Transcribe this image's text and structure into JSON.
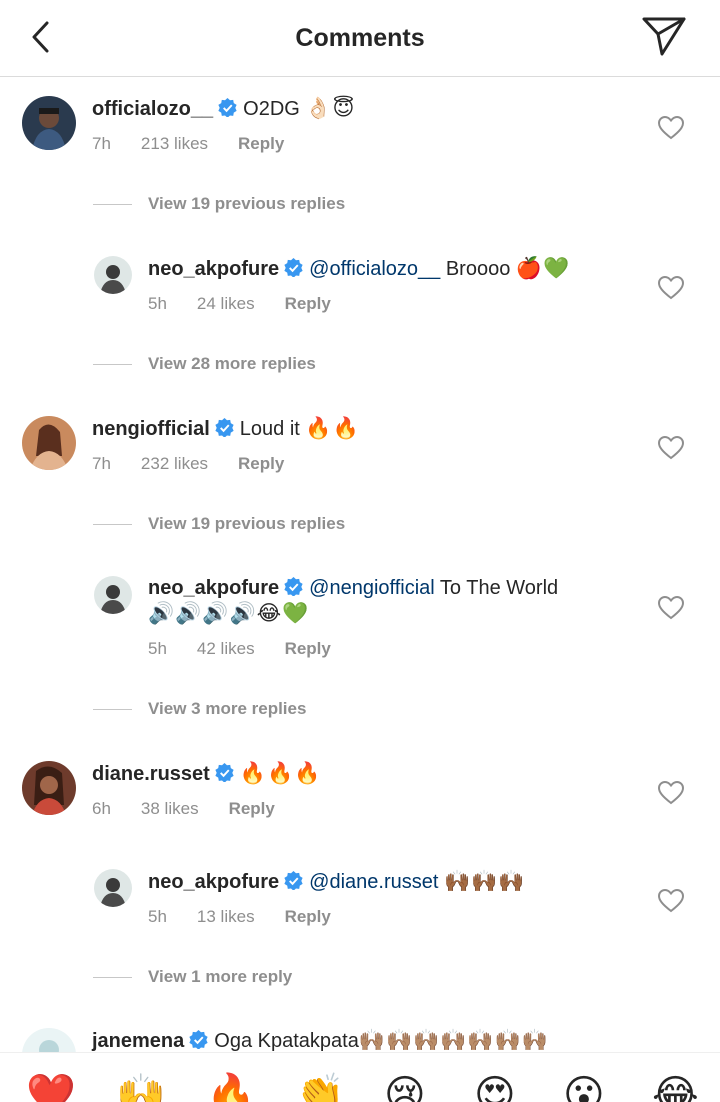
{
  "header": {
    "title": "Comments",
    "back_icon": "chevron-left-icon",
    "send_icon": "paper-plane-icon"
  },
  "comments": [
    {
      "username": "officialozo__",
      "text": "O2DG",
      "emoji": "👌🏻😇",
      "time": "7h",
      "likes": "213 likes",
      "reply": "Reply",
      "view_link": "View 19 previous replies",
      "reply_item": {
        "username": "neo_akpofure",
        "mention": "@officialozo__",
        "text": " Broooo",
        "emoji": "🍎💚",
        "time": "5h",
        "likes": "24 likes",
        "reply": "Reply"
      },
      "more_link": "View 28 more replies"
    },
    {
      "username": "nengiofficial",
      "text": "Loud it",
      "emoji": "🔥🔥",
      "time": "7h",
      "likes": "232 likes",
      "reply": "Reply",
      "view_link": "View 19 previous replies",
      "reply_item": {
        "username": "neo_akpofure",
        "mention": "@nengiofficial",
        "text": " To The World",
        "emoji_line2": "🔊🔊🔊🔊😂💚",
        "time": "5h",
        "likes": "42 likes",
        "reply": "Reply"
      },
      "more_link": "View 3 more replies"
    },
    {
      "username": "diane.russet",
      "text": "",
      "emoji": "🔥🔥🔥",
      "time": "6h",
      "likes": "38 likes",
      "reply": "Reply",
      "reply_item": {
        "username": "neo_akpofure",
        "mention": "@diane.russet",
        "text": " ",
        "emoji": "🙌🏾🙌🏾🙌🏾",
        "time": "5h",
        "likes": "13 likes",
        "reply": "Reply"
      },
      "more_link": "View 1 more reply"
    },
    {
      "username": "janemena",
      "text": "Oga Kpatakpata",
      "emoji": "🙌🏽🙌🏽🙌🏽🙌🏽🙌🏽🙌🏽🙌🏽"
    }
  ],
  "emoji_bar": [
    "❤️",
    "🙌",
    "🔥",
    "👏",
    "😢",
    "😍",
    "😮",
    "😂"
  ],
  "colors": {
    "verified": "#3897f0",
    "mention": "#00376b",
    "meta": "#8e8e8e",
    "divider": "#dbdbdb"
  }
}
